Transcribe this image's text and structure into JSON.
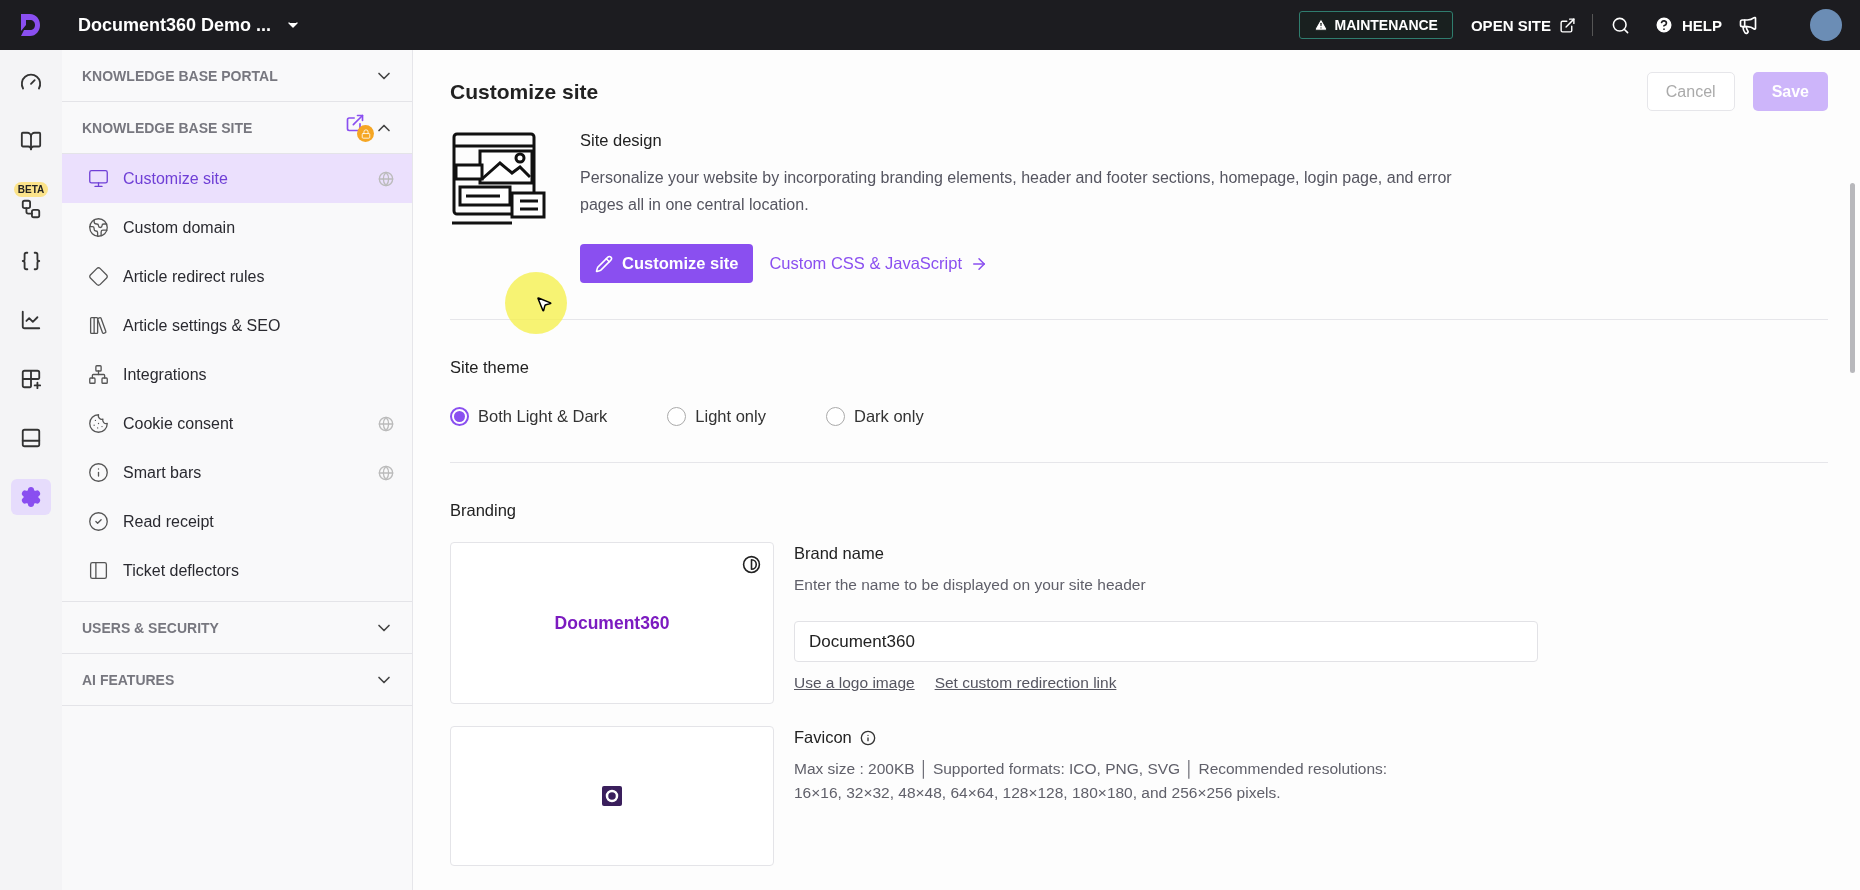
{
  "topbar": {
    "project": "Document360 Demo ...",
    "maintenance": "MAINTENANCE",
    "open_site": "OPEN SITE",
    "help": "HELP"
  },
  "rail": [
    {
      "kind": "gauge",
      "selected": false
    },
    {
      "kind": "book",
      "selected": false
    },
    {
      "kind": "flow",
      "selected": false,
      "badge": "BETA"
    },
    {
      "kind": "braces",
      "selected": false
    },
    {
      "kind": "chart",
      "selected": false
    },
    {
      "kind": "apps",
      "selected": false
    },
    {
      "kind": "panel",
      "selected": false
    },
    {
      "kind": "settings",
      "selected": true
    }
  ],
  "sidebar": {
    "sections": [
      {
        "title": "KNOWLEDGE BASE PORTAL",
        "expanded": false,
        "locked_link": false
      },
      {
        "title": "KNOWLEDGE BASE SITE",
        "expanded": true,
        "locked_link": true,
        "items": [
          {
            "label": "Customize site",
            "kind": "monitor",
            "selected": true,
            "globe": true
          },
          {
            "label": "Custom domain",
            "kind": "domain",
            "selected": false,
            "globe": false
          },
          {
            "label": "Article redirect rules",
            "kind": "redirect",
            "selected": false,
            "globe": false
          },
          {
            "label": "Article settings & SEO",
            "kind": "library",
            "selected": false,
            "globe": false
          },
          {
            "label": "Integrations",
            "kind": "network",
            "selected": false,
            "globe": false
          },
          {
            "label": "Cookie consent",
            "kind": "cookie",
            "selected": false,
            "globe": true
          },
          {
            "label": "Smart bars",
            "kind": "info",
            "selected": false,
            "globe": true
          },
          {
            "label": "Read receipt",
            "kind": "check",
            "selected": false,
            "globe": false
          },
          {
            "label": "Ticket deflectors",
            "kind": "deflector",
            "selected": false,
            "globe": false
          }
        ]
      },
      {
        "title": "USERS & SECURITY",
        "expanded": false,
        "locked_link": false
      },
      {
        "title": "AI FEATURES",
        "expanded": false,
        "locked_link": false
      }
    ]
  },
  "page": {
    "title": "Customize site",
    "buttons": [
      {
        "label": "Cancel",
        "kind": "secondary",
        "disabled": true
      },
      {
        "label": "Save",
        "kind": "primary",
        "disabled": true
      }
    ]
  },
  "site_design": {
    "title": "Site design",
    "description": "Personalize your website by incorporating branding elements, header and footer sections, homepage, login page, and error pages all in one central location.",
    "button": "Customize site",
    "link": "Custom CSS & JavaScript"
  },
  "site_theme": {
    "title": "Site theme",
    "options": [
      {
        "label": "Both Light & Dark",
        "selected": true
      },
      {
        "label": "Light only",
        "selected": false
      },
      {
        "label": "Dark only",
        "selected": false
      }
    ]
  },
  "branding": {
    "title": "Branding",
    "preview": "Document360",
    "brand_name": {
      "label": "Brand name",
      "hint": "Enter the name to be displayed on your site header",
      "value": "Document360"
    },
    "links": [
      "Use a logo image",
      "Set custom redirection link"
    ],
    "favicon": {
      "label": "Favicon",
      "info": "Max size : 200KB │ Supported formats: ICO, PNG, SVG  │ Recommended resolutions: 16×16, 32×32, 48×48, 64×64, 128×128, 180×180, and 256×256 pixels."
    }
  }
}
